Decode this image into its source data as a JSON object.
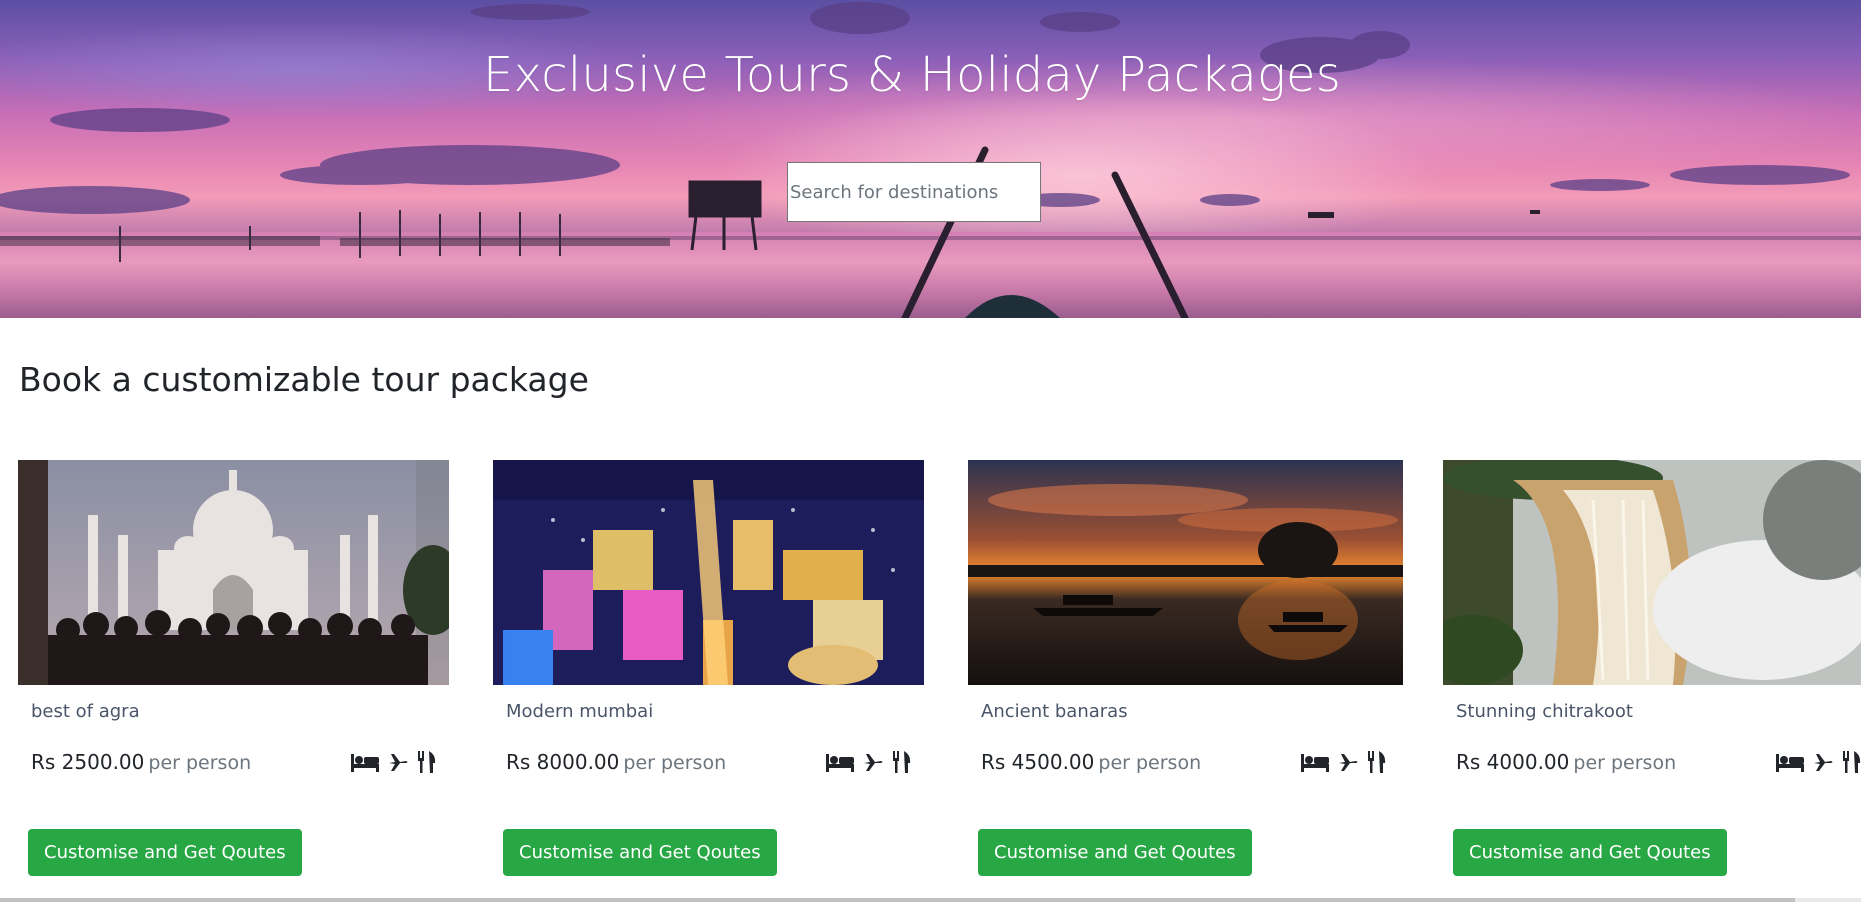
{
  "hero": {
    "title": "Exclusive Tours & Holiday Packages",
    "search_placeholder": "Search for destinations"
  },
  "section": {
    "title": "Book a customizable tour package"
  },
  "packages": [
    {
      "name": "best of agra",
      "price": "Rs 2500.00",
      "per": "per person",
      "button": "Customise and Get Qoutes",
      "image": "taj-mahal-photo"
    },
    {
      "name": "Modern mumbai",
      "price": "Rs 8000.00",
      "per": "per person",
      "button": "Customise and Get Qoutes",
      "image": "city-night-aerial-photo"
    },
    {
      "name": "Ancient banaras",
      "price": "Rs 4500.00",
      "per": "per person",
      "button": "Customise and Get Qoutes",
      "image": "river-sunset-boats-photo"
    },
    {
      "name": "Stunning chitrakoot",
      "price": "Rs 4000.00",
      "per": "per person",
      "button": "Customise and Get Qoutes",
      "image": "waterfall-photo"
    }
  ],
  "amenity_icons": [
    "bed-icon",
    "plane-icon",
    "utensils-icon"
  ],
  "colors": {
    "accent_button": "#28a745",
    "hero_sky": "#e685b4",
    "text_muted": "#6c757d"
  }
}
